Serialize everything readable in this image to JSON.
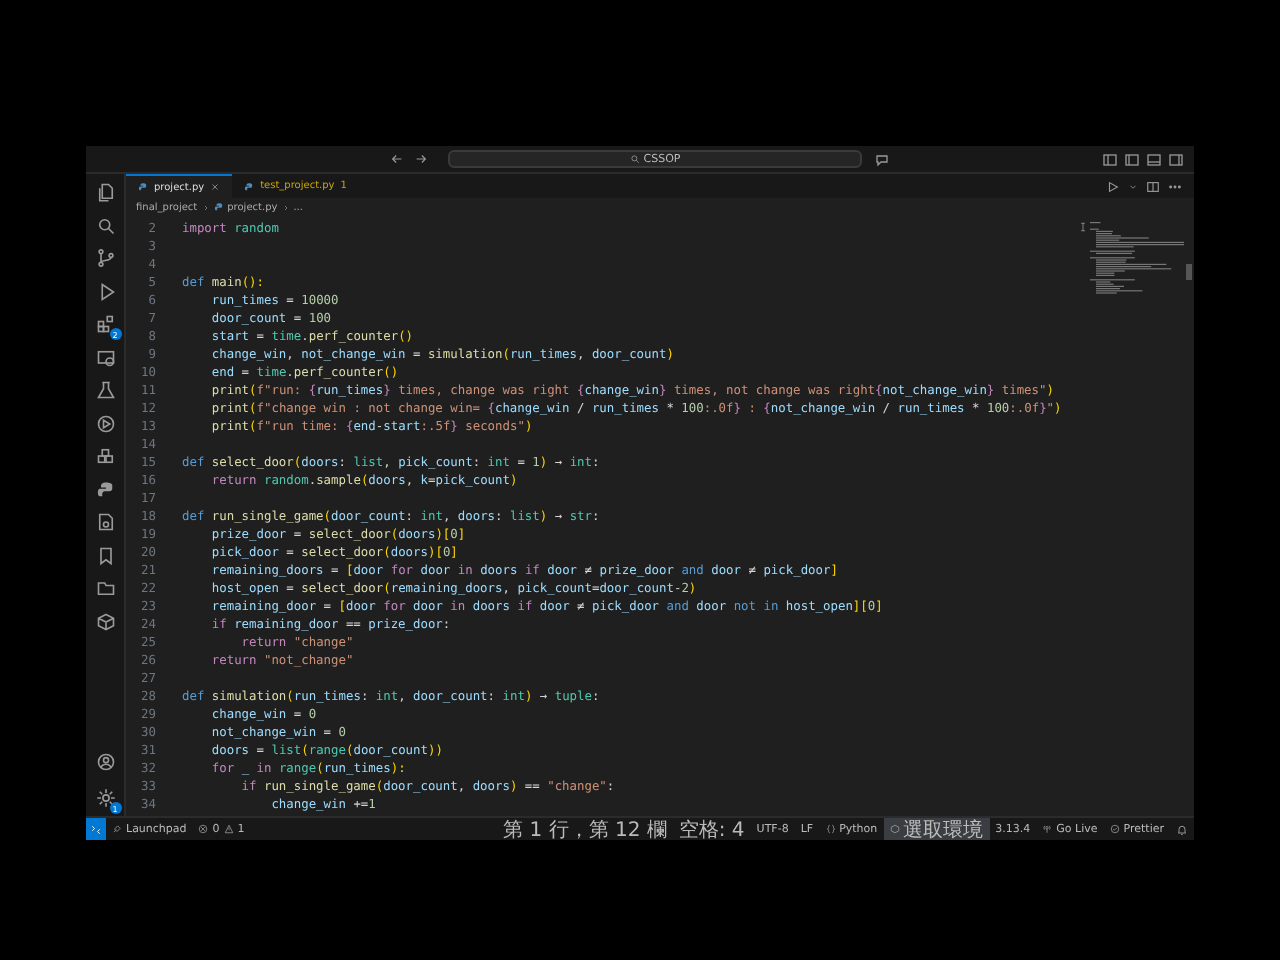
{
  "title_bar": {
    "search": "CSSOP"
  },
  "activity_bar": {
    "extensions_badge": "2",
    "settings_badge": "1"
  },
  "tabs": [
    {
      "label": "project.py",
      "selected": true
    },
    {
      "label": "test_project.py",
      "selected": false,
      "problems": "1"
    }
  ],
  "breadcrumb": [
    "final_project",
    "project.py",
    "..."
  ],
  "editor": {
    "lines": [
      {
        "number": "2",
        "tokens": [
          {
            "kind": "kw",
            "text": "import "
          },
          {
            "kind": "type",
            "text": "random"
          }
        ]
      },
      {
        "number": "3"
      },
      {
        "number": "4"
      },
      {
        "number": "5",
        "tokens": [
          {
            "kind": "def",
            "text": "def "
          },
          {
            "kind": "fn",
            "text": "main"
          },
          {
            "kind": "punc",
            "text": "():"
          }
        ]
      },
      {
        "number": "6",
        "tokens": [
          {
            "kind": "var",
            "text": "    run_times"
          },
          {
            "kind": "plain",
            "text": " = "
          },
          {
            "kind": "num",
            "text": "10000"
          }
        ]
      },
      {
        "number": "7",
        "tokens": [
          {
            "kind": "var",
            "text": "    door_count"
          },
          {
            "kind": "plain",
            "text": " = "
          },
          {
            "kind": "num",
            "text": "100"
          }
        ]
      },
      {
        "number": "8",
        "tokens": [
          {
            "kind": "var",
            "text": "    start"
          },
          {
            "kind": "plain",
            "text": " = "
          },
          {
            "kind": "type",
            "text": "time"
          },
          {
            "kind": "plain",
            "text": "."
          },
          {
            "kind": "fn",
            "text": "perf_counter"
          },
          {
            "kind": "punc",
            "text": "()"
          }
        ]
      },
      {
        "number": "9",
        "tokens": [
          {
            "kind": "var",
            "text": "    change_win"
          },
          {
            "kind": "plain",
            "text": ", "
          },
          {
            "kind": "var",
            "text": "not_change_win"
          },
          {
            "kind": "plain",
            "text": " = "
          },
          {
            "kind": "fn",
            "text": "simulation"
          },
          {
            "kind": "punc",
            "text": "("
          },
          {
            "kind": "var",
            "text": "run_times"
          },
          {
            "kind": "plain",
            "text": ", "
          },
          {
            "kind": "var",
            "text": "door_count"
          },
          {
            "kind": "punc",
            "text": ")"
          }
        ]
      },
      {
        "number": "10",
        "tokens": [
          {
            "kind": "var",
            "text": "    end"
          },
          {
            "kind": "plain",
            "text": " = "
          },
          {
            "kind": "type",
            "text": "time"
          },
          {
            "kind": "plain",
            "text": "."
          },
          {
            "kind": "fn",
            "text": "perf_counter"
          },
          {
            "kind": "punc",
            "text": "()"
          }
        ]
      },
      {
        "number": "11",
        "tokens": [
          {
            "kind": "fn",
            "text": "    print"
          },
          {
            "kind": "punc",
            "text": "("
          },
          {
            "kind": "str",
            "text": "f\"run: "
          },
          {
            "kind": "kw",
            "text": "{"
          },
          {
            "kind": "var",
            "text": "run_times"
          },
          {
            "kind": "kw",
            "text": "}"
          },
          {
            "kind": "str",
            "text": " times, change was right "
          },
          {
            "kind": "kw",
            "text": "{"
          },
          {
            "kind": "var",
            "text": "change_win"
          },
          {
            "kind": "kw",
            "text": "}"
          },
          {
            "kind": "str",
            "text": " times, not change was right"
          },
          {
            "kind": "kw",
            "text": "{"
          },
          {
            "kind": "var",
            "text": "not_change_win"
          },
          {
            "kind": "kw",
            "text": "}"
          },
          {
            "kind": "str",
            "text": " times\""
          },
          {
            "kind": "punc",
            "text": ")"
          }
        ]
      },
      {
        "number": "12",
        "tokens": [
          {
            "kind": "fn",
            "text": "    print"
          },
          {
            "kind": "punc",
            "text": "("
          },
          {
            "kind": "str",
            "text": "f\"change win : not change win= "
          },
          {
            "kind": "kw",
            "text": "{"
          },
          {
            "kind": "var",
            "text": "change_win"
          },
          {
            "kind": "plain",
            "text": " / "
          },
          {
            "kind": "var",
            "text": "run_times"
          },
          {
            "kind": "plain",
            "text": " * "
          },
          {
            "kind": "num",
            "text": "100"
          },
          {
            "kind": "str",
            "text": ":.0f"
          },
          {
            "kind": "kw",
            "text": "}"
          },
          {
            "kind": "str",
            "text": " : "
          },
          {
            "kind": "kw",
            "text": "{"
          },
          {
            "kind": "var",
            "text": "not_change_win"
          },
          {
            "kind": "plain",
            "text": " / "
          },
          {
            "kind": "var",
            "text": "run_times"
          },
          {
            "kind": "plain",
            "text": " * "
          },
          {
            "kind": "num",
            "text": "100"
          },
          {
            "kind": "str",
            "text": ":.0f"
          },
          {
            "kind": "kw",
            "text": "}"
          },
          {
            "kind": "str",
            "text": "\""
          },
          {
            "kind": "punc",
            "text": ")"
          }
        ]
      },
      {
        "number": "13",
        "tokens": [
          {
            "kind": "fn",
            "text": "    print"
          },
          {
            "kind": "punc",
            "text": "("
          },
          {
            "kind": "str",
            "text": "f\"run time: "
          },
          {
            "kind": "kw",
            "text": "{"
          },
          {
            "kind": "var",
            "text": "end"
          },
          {
            "kind": "plain",
            "text": "-"
          },
          {
            "kind": "var",
            "text": "start"
          },
          {
            "kind": "str",
            "text": ":.5f"
          },
          {
            "kind": "kw",
            "text": "}"
          },
          {
            "kind": "str",
            "text": " seconds\""
          },
          {
            "kind": "punc",
            "text": ")"
          }
        ]
      },
      {
        "number": "14"
      },
      {
        "number": "15",
        "tokens": [
          {
            "kind": "def",
            "text": "def "
          },
          {
            "kind": "fn",
            "text": "select_door"
          },
          {
            "kind": "punc",
            "text": "("
          },
          {
            "kind": "var",
            "text": "doors"
          },
          {
            "kind": "plain",
            "text": ": "
          },
          {
            "kind": "type",
            "text": "list"
          },
          {
            "kind": "plain",
            "text": ", "
          },
          {
            "kind": "var",
            "text": "pick_count"
          },
          {
            "kind": "plain",
            "text": ": "
          },
          {
            "kind": "type",
            "text": "int"
          },
          {
            "kind": "plain",
            "text": " = "
          },
          {
            "kind": "num",
            "text": "1"
          },
          {
            "kind": "punc",
            "text": ")"
          },
          {
            "kind": "plain",
            "text": " → "
          },
          {
            "kind": "type",
            "text": "int"
          },
          {
            "kind": "plain",
            "text": ":"
          }
        ]
      },
      {
        "number": "16",
        "tokens": [
          {
            "kind": "kw",
            "text": "    return "
          },
          {
            "kind": "type",
            "text": "random"
          },
          {
            "kind": "plain",
            "text": "."
          },
          {
            "kind": "fn",
            "text": "sample"
          },
          {
            "kind": "punc",
            "text": "("
          },
          {
            "kind": "var",
            "text": "doors"
          },
          {
            "kind": "plain",
            "text": ", "
          },
          {
            "kind": "var",
            "text": "k"
          },
          {
            "kind": "plain",
            "text": "="
          },
          {
            "kind": "var",
            "text": "pick_count"
          },
          {
            "kind": "punc",
            "text": ")"
          }
        ]
      },
      {
        "number": "17"
      },
      {
        "number": "18",
        "tokens": [
          {
            "kind": "def",
            "text": "def "
          },
          {
            "kind": "fn",
            "text": "run_single_game"
          },
          {
            "kind": "punc",
            "text": "("
          },
          {
            "kind": "var",
            "text": "door_count"
          },
          {
            "kind": "plain",
            "text": ": "
          },
          {
            "kind": "type",
            "text": "int"
          },
          {
            "kind": "plain",
            "text": ", "
          },
          {
            "kind": "var",
            "text": "doors"
          },
          {
            "kind": "plain",
            "text": ": "
          },
          {
            "kind": "type",
            "text": "list"
          },
          {
            "kind": "punc",
            "text": ")"
          },
          {
            "kind": "plain",
            "text": " → "
          },
          {
            "kind": "type",
            "text": "str"
          },
          {
            "kind": "plain",
            "text": ":"
          }
        ]
      },
      {
        "number": "19",
        "tokens": [
          {
            "kind": "var",
            "text": "    prize_door"
          },
          {
            "kind": "plain",
            "text": " = "
          },
          {
            "kind": "fn",
            "text": "select_door"
          },
          {
            "kind": "punc",
            "text": "("
          },
          {
            "kind": "var",
            "text": "doors"
          },
          {
            "kind": "punc",
            "text": ")["
          },
          {
            "kind": "num",
            "text": "0"
          },
          {
            "kind": "punc",
            "text": "]"
          }
        ]
      },
      {
        "number": "20",
        "tokens": [
          {
            "kind": "var",
            "text": "    pick_door"
          },
          {
            "kind": "plain",
            "text": " = "
          },
          {
            "kind": "fn",
            "text": "select_door"
          },
          {
            "kind": "punc",
            "text": "("
          },
          {
            "kind": "var",
            "text": "doors"
          },
          {
            "kind": "punc",
            "text": ")["
          },
          {
            "kind": "num",
            "text": "0"
          },
          {
            "kind": "punc",
            "text": "]"
          }
        ]
      },
      {
        "number": "21",
        "tokens": [
          {
            "kind": "var",
            "text": "    remaining_doors"
          },
          {
            "kind": "plain",
            "text": " = "
          },
          {
            "kind": "punc",
            "text": "["
          },
          {
            "kind": "var",
            "text": "door "
          },
          {
            "kind": "kw",
            "text": "for "
          },
          {
            "kind": "var",
            "text": "door "
          },
          {
            "kind": "kw",
            "text": "in "
          },
          {
            "kind": "var",
            "text": "doors "
          },
          {
            "kind": "kw",
            "text": "if "
          },
          {
            "kind": "var",
            "text": "door"
          },
          {
            "kind": "plain",
            "text": " ≠ "
          },
          {
            "kind": "var",
            "text": "prize_door "
          },
          {
            "kind": "def",
            "text": "and "
          },
          {
            "kind": "var",
            "text": "door"
          },
          {
            "kind": "plain",
            "text": " ≠ "
          },
          {
            "kind": "var",
            "text": "pick_door"
          },
          {
            "kind": "punc",
            "text": "]"
          }
        ]
      },
      {
        "number": "22",
        "tokens": [
          {
            "kind": "var",
            "text": "    host_open"
          },
          {
            "kind": "plain",
            "text": " = "
          },
          {
            "kind": "fn",
            "text": "select_door"
          },
          {
            "kind": "punc",
            "text": "("
          },
          {
            "kind": "var",
            "text": "remaining_doors"
          },
          {
            "kind": "plain",
            "text": ", "
          },
          {
            "kind": "var",
            "text": "pick_count"
          },
          {
            "kind": "plain",
            "text": "="
          },
          {
            "kind": "var",
            "text": "door_count"
          },
          {
            "kind": "plain",
            "text": "-"
          },
          {
            "kind": "num",
            "text": "2"
          },
          {
            "kind": "punc",
            "text": ")"
          }
        ]
      },
      {
        "number": "23",
        "tokens": [
          {
            "kind": "var",
            "text": "    remaining_door"
          },
          {
            "kind": "plain",
            "text": " = "
          },
          {
            "kind": "punc",
            "text": "["
          },
          {
            "kind": "var",
            "text": "door "
          },
          {
            "kind": "kw",
            "text": "for "
          },
          {
            "kind": "var",
            "text": "door "
          },
          {
            "kind": "kw",
            "text": "in "
          },
          {
            "kind": "var",
            "text": "doors "
          },
          {
            "kind": "kw",
            "text": "if "
          },
          {
            "kind": "var",
            "text": "door"
          },
          {
            "kind": "plain",
            "text": " ≠ "
          },
          {
            "kind": "var",
            "text": "pick_door "
          },
          {
            "kind": "def",
            "text": "and "
          },
          {
            "kind": "var",
            "text": "door "
          },
          {
            "kind": "def",
            "text": "not in "
          },
          {
            "kind": "var",
            "text": "host_open"
          },
          {
            "kind": "punc",
            "text": "]["
          },
          {
            "kind": "num",
            "text": "0"
          },
          {
            "kind": "punc",
            "text": "]"
          }
        ]
      },
      {
        "number": "24",
        "tokens": [
          {
            "kind": "kw",
            "text": "    if "
          },
          {
            "kind": "var",
            "text": "remaining_door"
          },
          {
            "kind": "plain",
            "text": " == "
          },
          {
            "kind": "var",
            "text": "prize_door"
          },
          {
            "kind": "plain",
            "text": ":"
          }
        ]
      },
      {
        "number": "25",
        "tokens": [
          {
            "kind": "kw",
            "text": "        return "
          },
          {
            "kind": "str",
            "text": "\"change\""
          }
        ]
      },
      {
        "number": "26",
        "tokens": [
          {
            "kind": "kw",
            "text": "    return "
          },
          {
            "kind": "str",
            "text": "\"not_change\""
          }
        ]
      },
      {
        "number": "27"
      },
      {
        "number": "28",
        "tokens": [
          {
            "kind": "def",
            "text": "def "
          },
          {
            "kind": "fn",
            "text": "simulation"
          },
          {
            "kind": "punc",
            "text": "("
          },
          {
            "kind": "var",
            "text": "run_times"
          },
          {
            "kind": "plain",
            "text": ": "
          },
          {
            "kind": "type",
            "text": "int"
          },
          {
            "kind": "plain",
            "text": ", "
          },
          {
            "kind": "var",
            "text": "door_count"
          },
          {
            "kind": "plain",
            "text": ": "
          },
          {
            "kind": "type",
            "text": "int"
          },
          {
            "kind": "punc",
            "text": ")"
          },
          {
            "kind": "plain",
            "text": " → "
          },
          {
            "kind": "type",
            "text": "tuple"
          },
          {
            "kind": "plain",
            "text": ":"
          }
        ]
      },
      {
        "number": "29",
        "tokens": [
          {
            "kind": "var",
            "text": "    change_win"
          },
          {
            "kind": "plain",
            "text": " = "
          },
          {
            "kind": "num",
            "text": "0"
          }
        ]
      },
      {
        "number": "30",
        "tokens": [
          {
            "kind": "var",
            "text": "    not_change_win"
          },
          {
            "kind": "plain",
            "text": " = "
          },
          {
            "kind": "num",
            "text": "0"
          }
        ]
      },
      {
        "number": "31",
        "tokens": [
          {
            "kind": "var",
            "text": "    doors"
          },
          {
            "kind": "plain",
            "text": " = "
          },
          {
            "kind": "type",
            "text": "list"
          },
          {
            "kind": "punc",
            "text": "("
          },
          {
            "kind": "type",
            "text": "range"
          },
          {
            "kind": "punc",
            "text": "("
          },
          {
            "kind": "var",
            "text": "door_count"
          },
          {
            "kind": "punc",
            "text": "))"
          }
        ]
      },
      {
        "number": "32",
        "tokens": [
          {
            "kind": "kw",
            "text": "    for "
          },
          {
            "kind": "var",
            "text": "_ "
          },
          {
            "kind": "kw",
            "text": "in "
          },
          {
            "kind": "type",
            "text": "range"
          },
          {
            "kind": "punc",
            "text": "("
          },
          {
            "kind": "var",
            "text": "run_times"
          },
          {
            "kind": "punc",
            "text": "):"
          }
        ]
      },
      {
        "number": "33",
        "tokens": [
          {
            "kind": "kw",
            "text": "        if "
          },
          {
            "kind": "fn",
            "text": "run_single_game"
          },
          {
            "kind": "punc",
            "text": "("
          },
          {
            "kind": "var",
            "text": "door_count"
          },
          {
            "kind": "plain",
            "text": ", "
          },
          {
            "kind": "var",
            "text": "doors"
          },
          {
            "kind": "punc",
            "text": ")"
          },
          {
            "kind": "plain",
            "text": " == "
          },
          {
            "kind": "str",
            "text": "\"change\""
          },
          {
            "kind": "plain",
            "text": ":"
          }
        ]
      },
      {
        "number": "34",
        "tokens": [
          {
            "kind": "var",
            "text": "            change_win"
          },
          {
            "kind": "plain",
            "text": " +="
          },
          {
            "kind": "num",
            "text": "1"
          }
        ]
      }
    ]
  },
  "status_bar": {
    "left": {
      "launchpad": "Launchpad",
      "errors": "0",
      "warnings": "1"
    },
    "right": [
      {
        "kind": "text",
        "text": "第 1 行，第 12 欄",
        "highlighted": false
      },
      {
        "kind": "text",
        "text": "空格: 4",
        "highlighted": false
      },
      {
        "kind": "text",
        "text": "UTF-8",
        "highlighted": false
      },
      {
        "kind": "text",
        "text": "LF",
        "highlighted": false
      },
      {
        "kind": "language",
        "text": "Python",
        "highlighted": false
      },
      {
        "kind": "env",
        "text": "選取環境",
        "highlighted": true
      },
      {
        "kind": "text",
        "text": "3.13.4",
        "highlighted": false
      },
      {
        "kind": "live",
        "text": "Go Live",
        "highlighted": false
      },
      {
        "kind": "prettier",
        "text": "Prettier",
        "highlighted": false
      },
      {
        "kind": "bell",
        "highlighted": false
      }
    ]
  }
}
